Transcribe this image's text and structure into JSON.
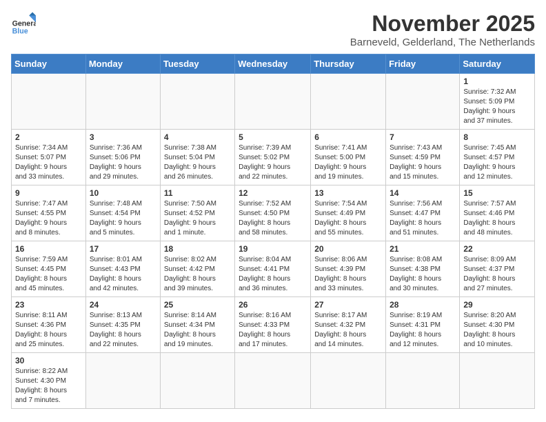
{
  "header": {
    "logo_general": "General",
    "logo_blue": "Blue",
    "month_title": "November 2025",
    "location": "Barneveld, Gelderland, The Netherlands"
  },
  "weekdays": [
    "Sunday",
    "Monday",
    "Tuesday",
    "Wednesday",
    "Thursday",
    "Friday",
    "Saturday"
  ],
  "weeks": [
    [
      {
        "day": "",
        "info": ""
      },
      {
        "day": "",
        "info": ""
      },
      {
        "day": "",
        "info": ""
      },
      {
        "day": "",
        "info": ""
      },
      {
        "day": "",
        "info": ""
      },
      {
        "day": "",
        "info": ""
      },
      {
        "day": "1",
        "info": "Sunrise: 7:32 AM\nSunset: 5:09 PM\nDaylight: 9 hours\nand 37 minutes."
      }
    ],
    [
      {
        "day": "2",
        "info": "Sunrise: 7:34 AM\nSunset: 5:07 PM\nDaylight: 9 hours\nand 33 minutes."
      },
      {
        "day": "3",
        "info": "Sunrise: 7:36 AM\nSunset: 5:06 PM\nDaylight: 9 hours\nand 29 minutes."
      },
      {
        "day": "4",
        "info": "Sunrise: 7:38 AM\nSunset: 5:04 PM\nDaylight: 9 hours\nand 26 minutes."
      },
      {
        "day": "5",
        "info": "Sunrise: 7:39 AM\nSunset: 5:02 PM\nDaylight: 9 hours\nand 22 minutes."
      },
      {
        "day": "6",
        "info": "Sunrise: 7:41 AM\nSunset: 5:00 PM\nDaylight: 9 hours\nand 19 minutes."
      },
      {
        "day": "7",
        "info": "Sunrise: 7:43 AM\nSunset: 4:59 PM\nDaylight: 9 hours\nand 15 minutes."
      },
      {
        "day": "8",
        "info": "Sunrise: 7:45 AM\nSunset: 4:57 PM\nDaylight: 9 hours\nand 12 minutes."
      }
    ],
    [
      {
        "day": "9",
        "info": "Sunrise: 7:47 AM\nSunset: 4:55 PM\nDaylight: 9 hours\nand 8 minutes."
      },
      {
        "day": "10",
        "info": "Sunrise: 7:48 AM\nSunset: 4:54 PM\nDaylight: 9 hours\nand 5 minutes."
      },
      {
        "day": "11",
        "info": "Sunrise: 7:50 AM\nSunset: 4:52 PM\nDaylight: 9 hours\nand 1 minute."
      },
      {
        "day": "12",
        "info": "Sunrise: 7:52 AM\nSunset: 4:50 PM\nDaylight: 8 hours\nand 58 minutes."
      },
      {
        "day": "13",
        "info": "Sunrise: 7:54 AM\nSunset: 4:49 PM\nDaylight: 8 hours\nand 55 minutes."
      },
      {
        "day": "14",
        "info": "Sunrise: 7:56 AM\nSunset: 4:47 PM\nDaylight: 8 hours\nand 51 minutes."
      },
      {
        "day": "15",
        "info": "Sunrise: 7:57 AM\nSunset: 4:46 PM\nDaylight: 8 hours\nand 48 minutes."
      }
    ],
    [
      {
        "day": "16",
        "info": "Sunrise: 7:59 AM\nSunset: 4:45 PM\nDaylight: 8 hours\nand 45 minutes."
      },
      {
        "day": "17",
        "info": "Sunrise: 8:01 AM\nSunset: 4:43 PM\nDaylight: 8 hours\nand 42 minutes."
      },
      {
        "day": "18",
        "info": "Sunrise: 8:02 AM\nSunset: 4:42 PM\nDaylight: 8 hours\nand 39 minutes."
      },
      {
        "day": "19",
        "info": "Sunrise: 8:04 AM\nSunset: 4:41 PM\nDaylight: 8 hours\nand 36 minutes."
      },
      {
        "day": "20",
        "info": "Sunrise: 8:06 AM\nSunset: 4:39 PM\nDaylight: 8 hours\nand 33 minutes."
      },
      {
        "day": "21",
        "info": "Sunrise: 8:08 AM\nSunset: 4:38 PM\nDaylight: 8 hours\nand 30 minutes."
      },
      {
        "day": "22",
        "info": "Sunrise: 8:09 AM\nSunset: 4:37 PM\nDaylight: 8 hours\nand 27 minutes."
      }
    ],
    [
      {
        "day": "23",
        "info": "Sunrise: 8:11 AM\nSunset: 4:36 PM\nDaylight: 8 hours\nand 25 minutes."
      },
      {
        "day": "24",
        "info": "Sunrise: 8:13 AM\nSunset: 4:35 PM\nDaylight: 8 hours\nand 22 minutes."
      },
      {
        "day": "25",
        "info": "Sunrise: 8:14 AM\nSunset: 4:34 PM\nDaylight: 8 hours\nand 19 minutes."
      },
      {
        "day": "26",
        "info": "Sunrise: 8:16 AM\nSunset: 4:33 PM\nDaylight: 8 hours\nand 17 minutes."
      },
      {
        "day": "27",
        "info": "Sunrise: 8:17 AM\nSunset: 4:32 PM\nDaylight: 8 hours\nand 14 minutes."
      },
      {
        "day": "28",
        "info": "Sunrise: 8:19 AM\nSunset: 4:31 PM\nDaylight: 8 hours\nand 12 minutes."
      },
      {
        "day": "29",
        "info": "Sunrise: 8:20 AM\nSunset: 4:30 PM\nDaylight: 8 hours\nand 10 minutes."
      }
    ],
    [
      {
        "day": "30",
        "info": "Sunrise: 8:22 AM\nSunset: 4:30 PM\nDaylight: 8 hours\nand 7 minutes."
      },
      {
        "day": "",
        "info": ""
      },
      {
        "day": "",
        "info": ""
      },
      {
        "day": "",
        "info": ""
      },
      {
        "day": "",
        "info": ""
      },
      {
        "day": "",
        "info": ""
      },
      {
        "day": "",
        "info": ""
      }
    ]
  ]
}
